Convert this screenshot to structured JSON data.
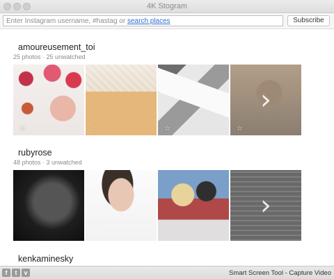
{
  "window": {
    "title": "4K Stogram"
  },
  "toolbar": {
    "search_placeholder": "Enter Instagram username, #hastag or ",
    "search_link": "search places",
    "subscribe_label": "Subscribe"
  },
  "sections": [
    {
      "name": "amoureusement_toi",
      "meta": "25 photos · 25 unwatched"
    },
    {
      "name": "rubyrose",
      "meta": "48 photos · 3 unwatched"
    },
    {
      "name": "kenkaminesky",
      "meta": ""
    }
  ],
  "icons": {
    "star": "star-icon",
    "next": "chevron-right-icon"
  },
  "bottombar": {
    "facebook": "f",
    "twitter": "t",
    "vimeo": "v",
    "promo": "Smart Screen Tool - Capture Video"
  }
}
